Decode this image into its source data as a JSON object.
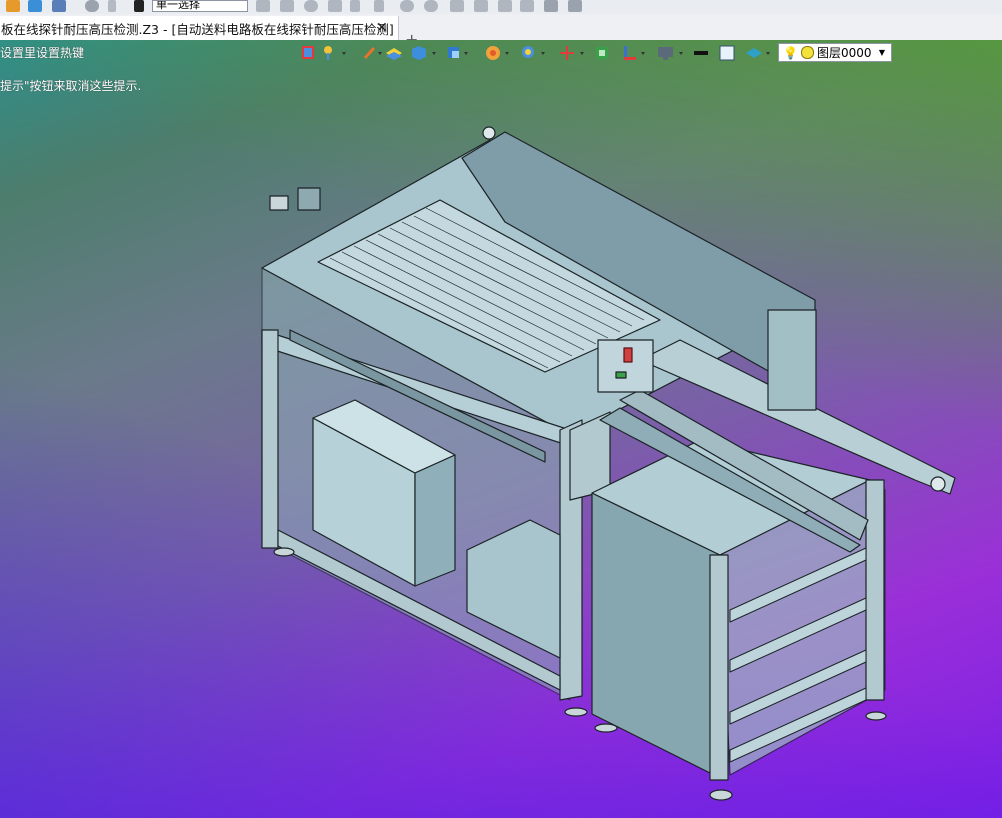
{
  "toolbar_top": {
    "selection_mode": "单一选择"
  },
  "tab": {
    "title": "板在线探针耐压高压检测.Z3 - [自动送料电路板在线探针耐压高压检测]",
    "close_icon": "close-icon",
    "add_icon": "plus-icon"
  },
  "hints": {
    "line1": "设置里设置热键",
    "line2": "提示\"按钮来取消这些提示."
  },
  "view_toolbar": {
    "layer_name": "图层0000",
    "icons": [
      "import-icon",
      "lightbulb-pin-icon",
      "pen-icon",
      "layer-stack-icon",
      "cube-shade-icon",
      "view-cube-icon",
      "render-wheel-icon",
      "zoom-fit-icon",
      "axis-origin-icon",
      "grid-snap-icon",
      "dimension-icon",
      "monitor-icon",
      "line-weight-icon",
      "color-swatch-icon",
      "layer-manager-icon",
      "lightbulb-icon",
      "layer-color-icon"
    ]
  },
  "colors": {
    "model_fill": "#9fbcc4",
    "model_line": "#1b2326",
    "bg_top_green": "#4aa036",
    "bg_magenta": "#c41fe6",
    "bg_blue": "#3b1fe0"
  }
}
